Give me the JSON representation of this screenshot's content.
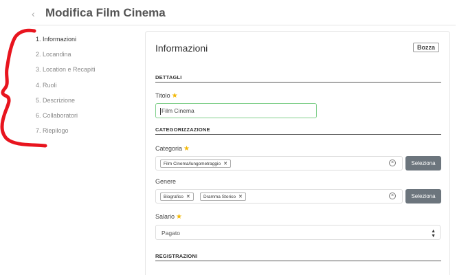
{
  "header": {
    "back_icon": "chevron-left-icon",
    "title": "Modifica Film Cinema"
  },
  "steps": [
    "1. Informazioni",
    "2. Locandina",
    "3. Location e Recapiti",
    "4. Ruoli",
    "5. Descrizione",
    "6. Collaboratori",
    "7. Riepilogo"
  ],
  "card": {
    "title": "Informazioni",
    "badge": "Bozza",
    "sections": {
      "details": "DETTAGLI",
      "categorization": "CATEGORIZZAZIONE",
      "registrations": "REGISTRAZIONI"
    },
    "fields": {
      "title_label": "Titolo",
      "title_value": "Film Cinema",
      "category_label": "Categoria",
      "category_tags": [
        "Film Cinema/lungometraggio"
      ],
      "genre_label": "Genere",
      "genre_tags": [
        "Biografico",
        "Dramma Storico"
      ],
      "salary_label": "Salario",
      "salary_value": "Pagato",
      "select_button": "Seleziona"
    }
  },
  "colors": {
    "annotation": "#e8141e",
    "required_star": "#f2b705",
    "active_input_border": "#7fcf8a",
    "button_bg": "#6c757d"
  }
}
